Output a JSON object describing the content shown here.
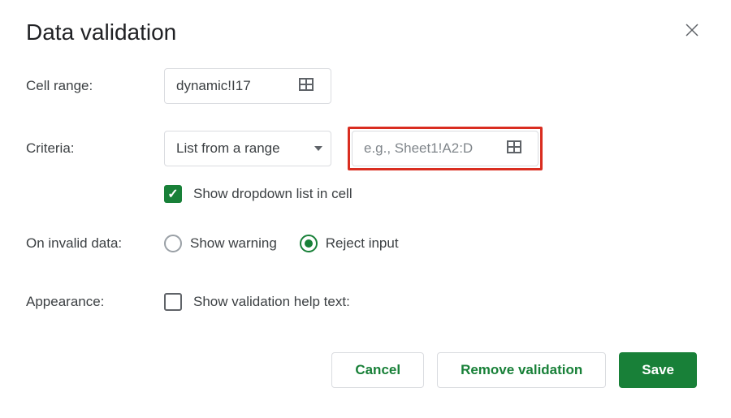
{
  "dialog": {
    "title": "Data validation",
    "fields": {
      "cell_range": {
        "label": "Cell range:",
        "value": "dynamic!I17"
      },
      "criteria": {
        "label": "Criteria:",
        "selected_option": "List from a range",
        "range_input": {
          "value": "",
          "placeholder": "e.g., Sheet1!A2:D"
        },
        "show_dropdown": {
          "checked": true,
          "label": "Show dropdown list in cell"
        }
      },
      "invalid_data": {
        "label": "On invalid data:",
        "options": {
          "warning": {
            "label": "Show warning",
            "selected": false
          },
          "reject": {
            "label": "Reject input",
            "selected": true
          }
        }
      },
      "appearance": {
        "label": "Appearance:",
        "help_text": {
          "checked": false,
          "label": "Show validation help text:"
        }
      }
    },
    "buttons": {
      "cancel": "Cancel",
      "remove": "Remove validation",
      "save": "Save"
    }
  },
  "colors": {
    "accent": "#188038",
    "highlight_border": "#d92d20"
  }
}
